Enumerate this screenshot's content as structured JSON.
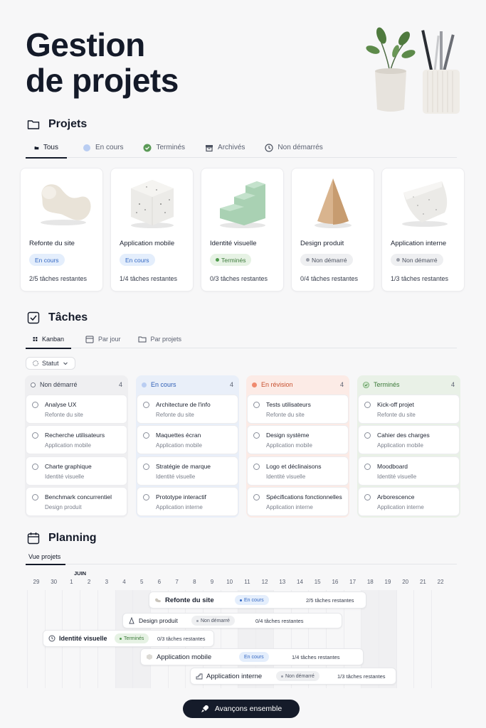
{
  "hero": {
    "title_line1": "Gestion",
    "title_line2": "de projets"
  },
  "projects": {
    "title": "Projets",
    "tabs": [
      {
        "label": "Tous",
        "icon": "folder-icon"
      },
      {
        "label": "En cours",
        "icon": "dot-icon"
      },
      {
        "label": "Terminés",
        "icon": "check-circle-icon"
      },
      {
        "label": "Archivés",
        "icon": "archive-icon"
      },
      {
        "label": "Non démarrés",
        "icon": "clock-icon"
      }
    ],
    "cards": [
      {
        "name": "Refonte du site",
        "status": "En cours",
        "remaining": "2/5 tâches restantes"
      },
      {
        "name": "Application mobile",
        "status": "En cours",
        "remaining": "1/4 tâches restantes"
      },
      {
        "name": "Identité visuelle",
        "status": "Terminés",
        "remaining": "0/3 tâches restantes"
      },
      {
        "name": "Design produit",
        "status": "Non démarré",
        "remaining": "0/4 tâches restantes"
      },
      {
        "name": "Application interne",
        "status": "Non démarré",
        "remaining": "1/3 tâches restantes"
      }
    ]
  },
  "tasks": {
    "title": "Tâches",
    "tabs": [
      "Kanban",
      "Par jour",
      "Par projets"
    ],
    "filter_label": "Statut",
    "columns": [
      {
        "title": "Non démarré",
        "count": "4",
        "items": [
          {
            "title": "Analyse UX",
            "project": "Refonte du site"
          },
          {
            "title": "Recherche utilisateurs",
            "project": "Application mobile"
          },
          {
            "title": "Charte graphique",
            "project": "Identité visuelle"
          },
          {
            "title": "Benchmark concurrentiel",
            "project": "Design produit"
          }
        ]
      },
      {
        "title": "En cours",
        "count": "4",
        "items": [
          {
            "title": "Architecture de l'info",
            "project": "Refonte du site"
          },
          {
            "title": "Maquettes écran",
            "project": "Application mobile"
          },
          {
            "title": "Stratégie de marque",
            "project": "Identité visuelle"
          },
          {
            "title": "Prototype interactif",
            "project": "Application interne"
          }
        ]
      },
      {
        "title": "En révision",
        "count": "4",
        "items": [
          {
            "title": "Tests utilisateurs",
            "project": "Refonte du site"
          },
          {
            "title": "Design système",
            "project": "Application mobile"
          },
          {
            "title": "Logo et déclinaisons",
            "project": "Identité visuelle"
          },
          {
            "title": "Spécifications fonctionnelles",
            "project": "Application interne"
          }
        ]
      },
      {
        "title": "Terminés",
        "count": "4",
        "items": [
          {
            "title": "Kick-off projet",
            "project": "Refonte du site"
          },
          {
            "title": "Cahier des charges",
            "project": "Application mobile"
          },
          {
            "title": "Moodboard",
            "project": "Identité visuelle"
          },
          {
            "title": "Arborescence",
            "project": "Application interne"
          }
        ]
      }
    ]
  },
  "planning": {
    "title": "Planning",
    "view_tab": "Vue projets",
    "month": "JUIN",
    "days": [
      "29",
      "30",
      "1",
      "2",
      "3",
      "4",
      "5",
      "6",
      "7",
      "8",
      "9",
      "10",
      "11",
      "12",
      "13",
      "14",
      "15",
      "16",
      "17",
      "18",
      "19",
      "20",
      "21",
      "22"
    ],
    "bars": [
      {
        "name": "Refonte du site",
        "status": "En cours",
        "remaining": "2/5 tâches restantes"
      },
      {
        "name": "Design produit",
        "status": "Non démarré",
        "remaining": "0/4 tâches restantes"
      },
      {
        "name": "Identité visuelle",
        "status": "Terminés",
        "remaining": "0/3 tâches restantes"
      },
      {
        "name": "Application mobile",
        "status": "En cours",
        "remaining": "1/4 tâches restantes"
      },
      {
        "name": "Application interne",
        "status": "Non démarré",
        "remaining": "1/3 tâches restantes"
      }
    ]
  },
  "cta": {
    "label": "Avançons ensemble",
    "icon": "rocket-icon"
  },
  "colors": {
    "primary": "#151b2a",
    "in_progress": "#3569c4",
    "done": "#3c7a3a",
    "review": "#d9553b",
    "not_started": "#4c5260"
  }
}
